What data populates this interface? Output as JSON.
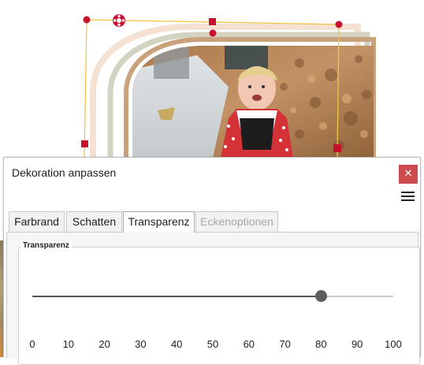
{
  "dialog": {
    "title": "Dekoration anpassen",
    "close_icon": "close-icon",
    "menu_icon": "hamburger-menu-icon"
  },
  "tabs": [
    {
      "label": "Farbrand",
      "state": "normal"
    },
    {
      "label": "Schatten",
      "state": "normal"
    },
    {
      "label": "Transparenz",
      "state": "active"
    },
    {
      "label": "Eckenoptionen",
      "state": "disabled"
    }
  ],
  "transparency": {
    "group_label": "Transparenz",
    "value": 80,
    "min": 0,
    "max": 100,
    "tick_labels": [
      "0",
      "10",
      "20",
      "30",
      "40",
      "50",
      "60",
      "70",
      "80",
      "90",
      "100"
    ]
  },
  "canvas": {
    "rotate_handle_icon": "rotate-handle-icon",
    "selection_color": "#f0c64a",
    "handle_color": "#c8102e"
  },
  "colors": {
    "close_button": "#cf4a4d",
    "frame_tan": "#c9a27c",
    "frame_sage": "#c9cbb8"
  }
}
